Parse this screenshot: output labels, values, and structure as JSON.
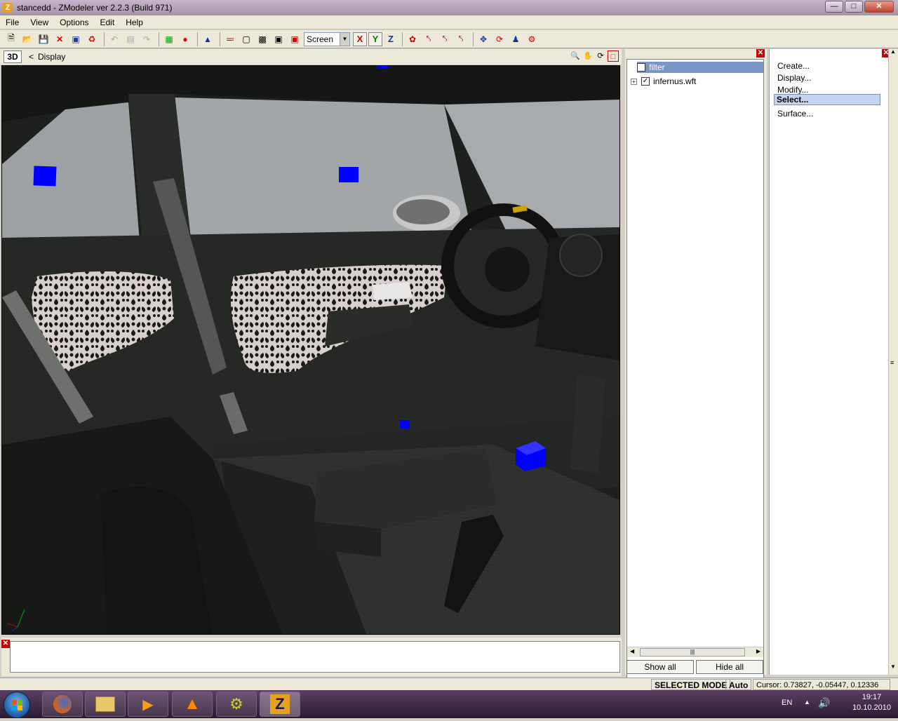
{
  "window": {
    "title": "stancedd - ZModeler ver 2.2.3 (Build 971)",
    "app_icon": "Z"
  },
  "menu": [
    "File",
    "View",
    "Options",
    "Edit",
    "Help"
  ],
  "toolbar": {
    "coord_select": "Screen",
    "axis_x": "X",
    "axis_y": "Y",
    "axis_z": "Z"
  },
  "viewport": {
    "mode": "3D",
    "back_glyph": "<",
    "name": "Display"
  },
  "outline": {
    "items": [
      {
        "label": "filter",
        "checked": "✓"
      },
      {
        "label": "infernus.wft",
        "checked": "✓",
        "expand": "+"
      }
    ],
    "show_all": "Show all",
    "hide_all": "Hide all",
    "scroll_thumb": "|||"
  },
  "commands": [
    "Create...",
    "Display...",
    "Modify...",
    "Select...",
    "Surface..."
  ],
  "status": {
    "mode": "SELECTED MODE",
    "auto": "Auto",
    "cursor": "Cursor: 0.73827, -0.05447, 0.12336"
  },
  "tray": {
    "lang": "EN",
    "time": "19:17",
    "date": "10.10.2010"
  },
  "colors": {
    "selection_blue": "#0000ff",
    "fabric_light": "#d8d0cc",
    "interior_dark": "#1c1e1c"
  }
}
